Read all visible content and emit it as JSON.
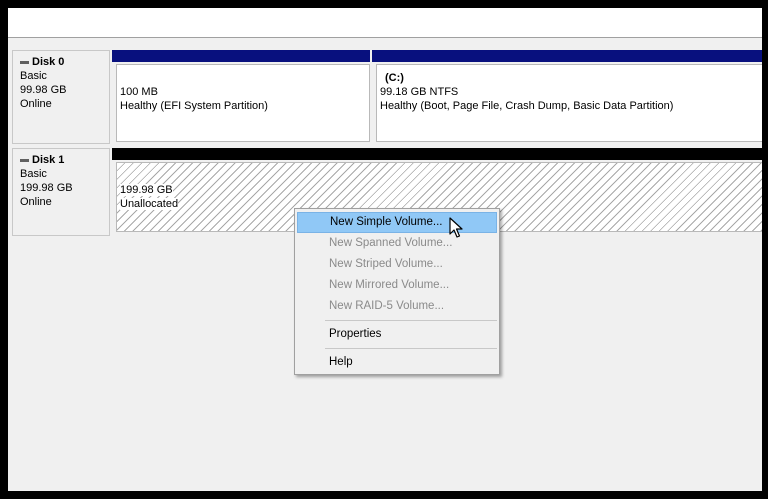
{
  "disks": [
    {
      "title": "Disk 0",
      "type": "Basic",
      "size": "99.98 GB",
      "status": "Online"
    },
    {
      "title": "Disk 1",
      "type": "Basic",
      "size": "199.98 GB",
      "status": "Online"
    }
  ],
  "volumes": {
    "efi": {
      "size": "100 MB",
      "status": "Healthy (EFI System Partition)"
    },
    "c": {
      "letter": "(C:)",
      "size_fs": "99.18 GB NTFS",
      "status": "Healthy (Boot, Page File, Crash Dump, Basic Data Partition)"
    },
    "unallocated": {
      "size": "199.98 GB",
      "label": "Unallocated"
    }
  },
  "context_menu": {
    "new_simple": "New Simple Volume...",
    "new_spanned": "New Spanned Volume...",
    "new_striped": "New Striped Volume...",
    "new_mirrored": "New Mirrored Volume...",
    "new_raid5": "New RAID-5 Volume...",
    "properties": "Properties",
    "help": "Help"
  },
  "colors": {
    "primary_partition_bar": "#08107e",
    "unallocated_bar": "#000000",
    "menu_highlight": "#90c8f6"
  },
  "icons": {
    "disk": "disk-icon",
    "cursor": "mouse-pointer-icon"
  }
}
